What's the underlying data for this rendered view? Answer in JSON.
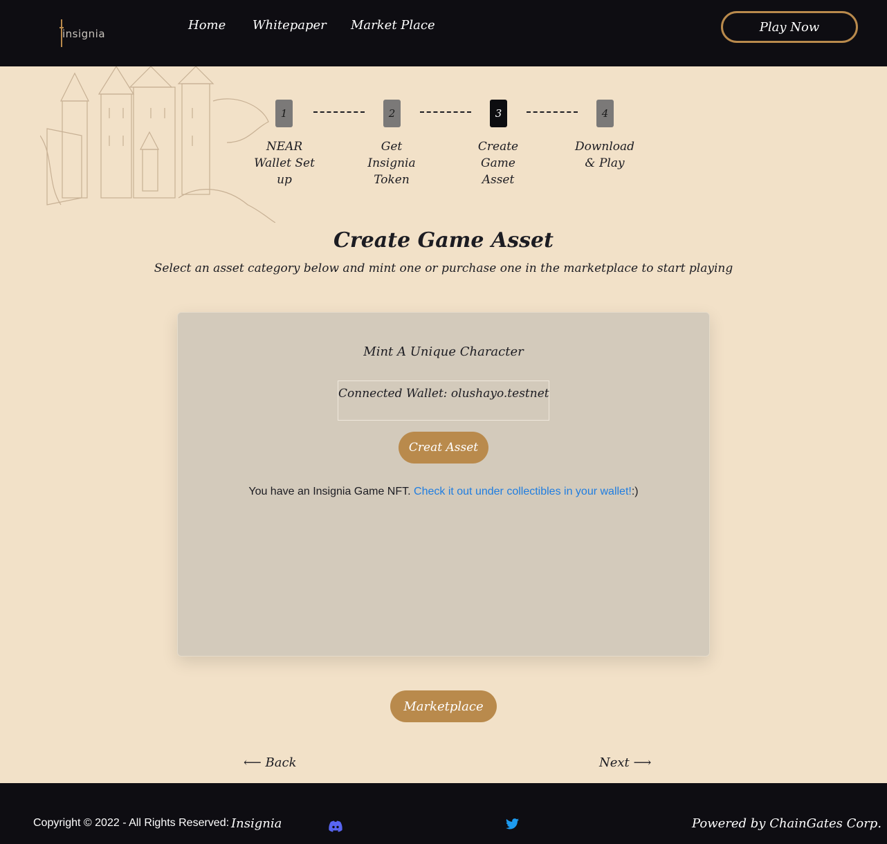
{
  "header": {
    "logo_text": "insignia",
    "nav": [
      "Home",
      "Whitepaper",
      "Market Place"
    ],
    "play_label": "Play Now"
  },
  "steps": [
    {
      "number": "1",
      "label": "NEAR Wallet Set up"
    },
    {
      "number": "2",
      "label": "Get Insignia Token"
    },
    {
      "number": "3",
      "label": "Create Game Asset"
    },
    {
      "number": "4",
      "label": "Download & Play"
    }
  ],
  "active_step": 3,
  "main": {
    "title": "Create Game Asset",
    "subtitle": "Select an asset category below and mint one or purchase one in the marketplace to start playing"
  },
  "card": {
    "title": "Mint A Unique Character",
    "wallet_text": "Connected Wallet: olushayo.testnet",
    "create_label": "Creat Asset",
    "note_text": "You have an Insignia Game NFT. ",
    "note_link": "Check it out under collectibles in your wallet!",
    "note_suffix": ":)"
  },
  "marketplace_label": "Marketplace",
  "back_label": "⟵ Back",
  "next_label": "Next ⟶",
  "footer": {
    "copyright": "Copyright © 2022 - All Rights Reserved:",
    "brand": "Insignia",
    "powered": "Powered by ChainGates Corp."
  },
  "icons": {
    "discord": "discord-icon",
    "twitter": "twitter-icon"
  },
  "colors": {
    "accent": "#b98a4c",
    "background": "#f2e1c8",
    "header": "#0e0d12",
    "link": "#1f7de0",
    "card": "#d3cabb"
  }
}
